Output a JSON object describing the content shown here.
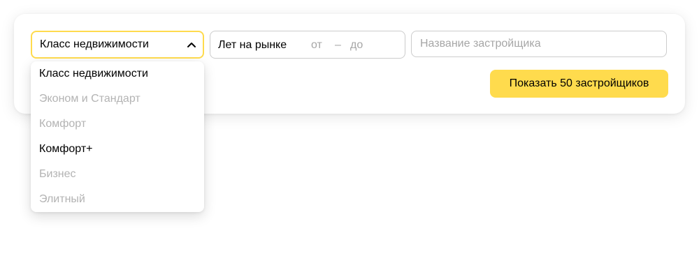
{
  "filters": {
    "property_class": {
      "label": "Класс недвижимости",
      "expanded": true,
      "options": [
        {
          "label": "Класс недвижимости",
          "enabled": true
        },
        {
          "label": "Эконом и Стандарт",
          "enabled": false
        },
        {
          "label": "Комфорт",
          "enabled": false
        },
        {
          "label": "Комфорт+",
          "enabled": true
        },
        {
          "label": "Бизнес",
          "enabled": false
        },
        {
          "label": "Элитный",
          "enabled": false
        }
      ]
    },
    "years_on_market": {
      "label": "Лет на рынке",
      "from_placeholder": "от",
      "separator": "–",
      "to_placeholder": "до"
    },
    "developer_name": {
      "placeholder": "Название застройщика"
    }
  },
  "actions": {
    "show_label": "Показать 50 застройщиков"
  },
  "colors": {
    "accent": "#ffdb4d",
    "border": "#cccccc",
    "placeholder": "#a6a6a6",
    "disabled_text": "#b3b3b3"
  },
  "icons": {
    "select_chevron": "chevron-up-icon"
  }
}
